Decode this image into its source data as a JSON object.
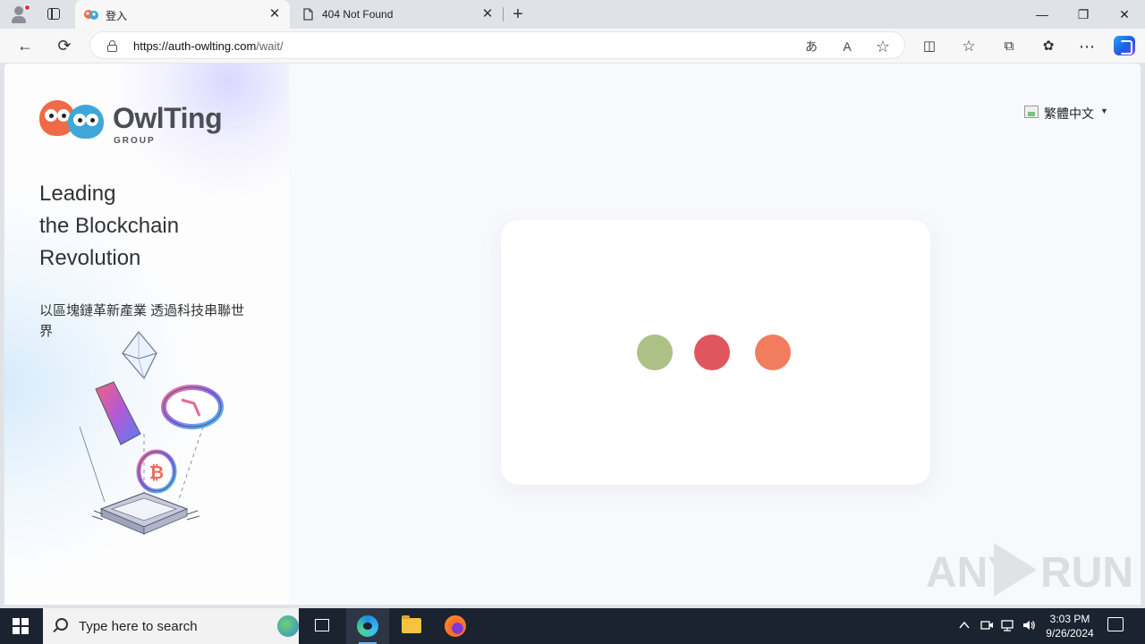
{
  "browser": {
    "tabs": [
      {
        "title": "登入",
        "active": true,
        "favicon": "owlting-favicon"
      },
      {
        "title": "404 Not Found",
        "active": false,
        "favicon": "page-icon"
      }
    ],
    "url_host": "https://auth-owlting.com",
    "url_path": "/wait/",
    "buttons": {
      "back": "←",
      "reload": "⟳",
      "new_tab": "+",
      "minimize": "—",
      "restore": "❐",
      "close": "✕",
      "tab_close": "✕",
      "translate": "あ",
      "read_aloud": "A",
      "favorite": "☆",
      "split": "◫",
      "favorites": "☆",
      "collections": "⧉",
      "extensions": "✿",
      "more": "⋯"
    }
  },
  "page": {
    "brand": {
      "name": "OwlTing",
      "sub": "GROUP"
    },
    "tagline_lines": [
      "Leading",
      "the Blockchain",
      "Revolution"
    ],
    "subtitle": "以區塊鏈革新產業 透過科技串聯世界",
    "language": {
      "label": "繁體中文",
      "caret": "▼"
    },
    "loader_colors": [
      "#adc086",
      "#e0565f",
      "#f17d5e"
    ],
    "watermark": {
      "left": "ANY",
      "right": "RUN"
    }
  },
  "taskbar": {
    "search_placeholder": "Type here to search",
    "time": "3:03 PM",
    "date": "9/26/2024",
    "tray_icons": [
      "chevron-up-icon",
      "meet-now-icon",
      "network-icon",
      "volume-icon"
    ]
  }
}
